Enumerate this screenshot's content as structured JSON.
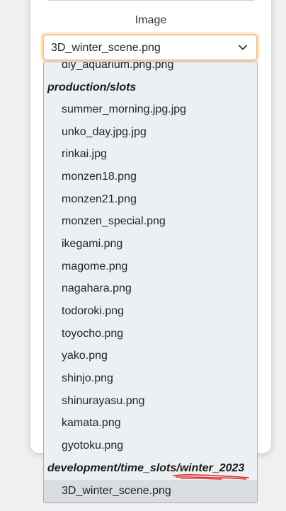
{
  "form": {
    "image_label": "Image",
    "selected_value": "3D_winter_scene.png"
  },
  "dropdown": {
    "cut_item": "diy_aquarium.png.png",
    "groups": [
      {
        "label": "production/slots",
        "items": [
          "summer_morning.jpg.jpg",
          "unko_day.jpg.jpg",
          "rinkai.jpg",
          "monzen18.png",
          "monzen21.png",
          "monzen_special.png",
          "ikegami.png",
          "magome.png",
          "nagahara.png",
          "todoroki.png",
          "toyocho.png",
          "yako.png",
          "shinjo.png",
          "shinurayasu.png",
          "kamata.png",
          "gyotoku.png"
        ]
      },
      {
        "label": "development/time_slots/winter_2023",
        "items": [
          "3D_winter_scene.png"
        ]
      }
    ]
  },
  "icons": {
    "chevron": "chevron-down-icon"
  },
  "colors": {
    "focus_border": "#f5c48a",
    "dropdown_bg": "#edf0f3",
    "selected_bg": "#d9dde2",
    "annotation": "#e02020"
  }
}
